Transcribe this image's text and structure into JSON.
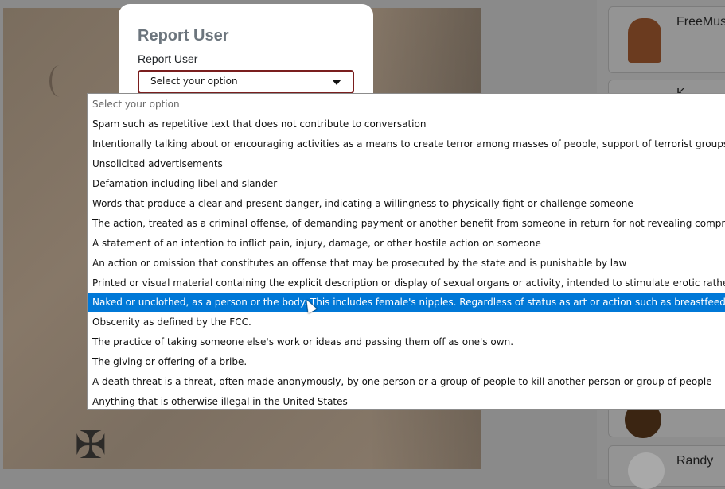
{
  "modal": {
    "title": "Report User",
    "field_label": "Report User",
    "select_value": "Select your option"
  },
  "dropdown": {
    "options": [
      "Select your option",
      "Spam such as repetitive text that does not contribute to conversation",
      "Intentionally talking about or encouraging activities as a means to create terror among masses of people, support of terrorist groups or org",
      "Unsolicited advertisements",
      "Defamation including libel and slander",
      "Words that produce a clear and present danger, indicating a willingness to physically fight or challenge someone",
      "The action, treated as a criminal offense, of demanding payment or another benefit from someone in return for not revealing compromising",
      "A statement of an intention to inflict pain, injury, damage, or other hostile action on someone",
      "An action or omission that constitutes an offense that may be prosecuted by the state and is punishable by law",
      "Printed or visual material containing the explicit description or display of sexual organs or activity, intended to stimulate erotic rather than a",
      "Naked or unclothed, as a person or the body. This includes female's nipples. Regardless of status as art or action such as breastfeeding",
      "Obscenity as defined by the FCC.",
      "The practice of taking someone else's work or ideas and passing them off as one's own.",
      "The giving or offering of a bribe.",
      "A death threat is a threat, often made anonymously, by one person or a group of people to kill another person or group of people",
      "Anything that is otherwise illegal in the United States"
    ],
    "selected_index": 10
  },
  "sidebar": {
    "cards": [
      {
        "name": "FreeMus",
        "icon": "jukebox-icon"
      },
      {
        "name": "K",
        "icon": "avatar-icon"
      },
      {
        "name": "",
        "icon": "badge-icon"
      },
      {
        "name": "Randy",
        "icon": "clock-icon"
      }
    ]
  },
  "colors": {
    "accent": "#0078d7",
    "select_border": "#7a1e1e",
    "title": "#6c757d"
  }
}
